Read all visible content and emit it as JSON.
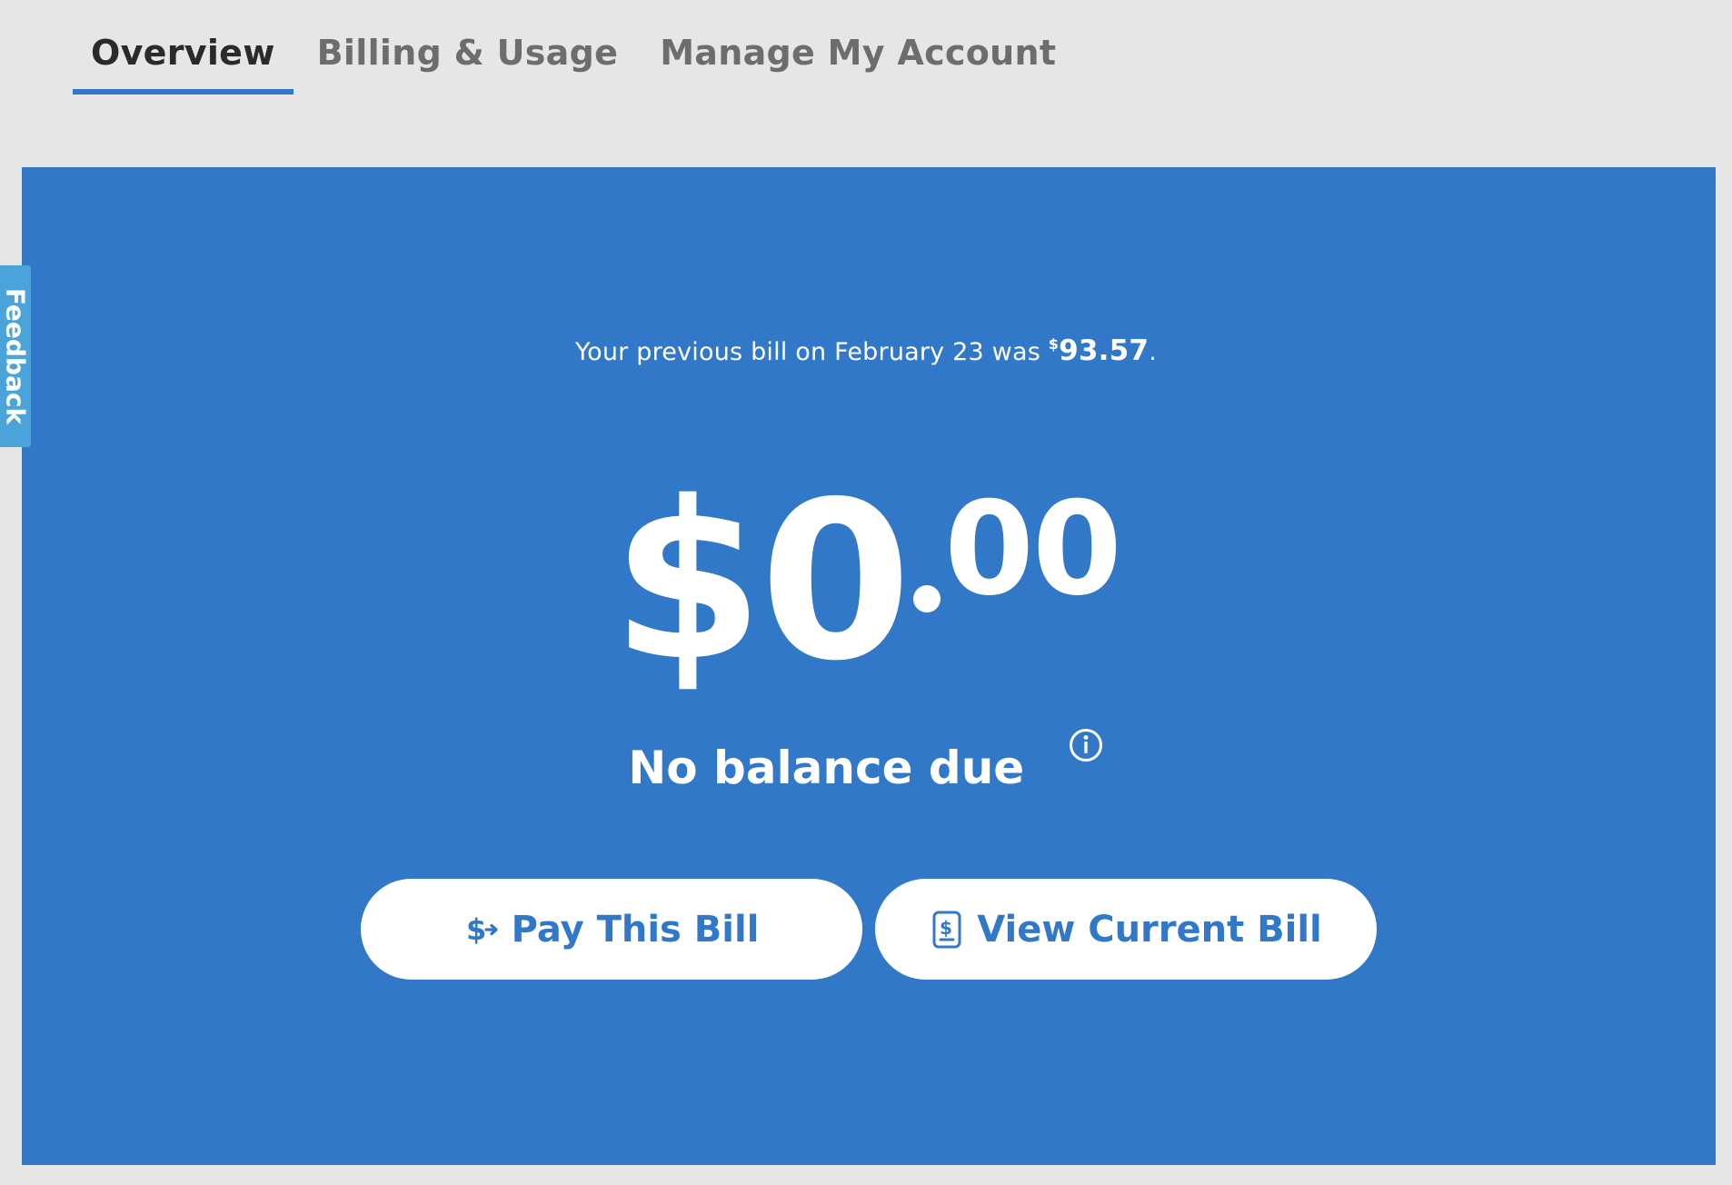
{
  "tabs": [
    {
      "label": "Overview",
      "active": true
    },
    {
      "label": "Billing & Usage",
      "active": false
    },
    {
      "label": "Manage My Account",
      "active": false
    }
  ],
  "feedback": {
    "label": "Feedback"
  },
  "previous_bill": {
    "prefix": "Your previous bill on February 23 was ",
    "currency_symbol": "$",
    "amount": "93.57",
    "suffix": "."
  },
  "balance": {
    "whole": "$0",
    "cents": "00",
    "status": "No balance due"
  },
  "buttons": {
    "pay_label": "Pay This Bill",
    "view_label": "View Current Bill"
  },
  "icons": {
    "pay": "dollar-transfer-icon",
    "view": "bill-document-icon",
    "info": "info-icon"
  },
  "colors": {
    "accent": "#3178c9",
    "background": "#e6e6e6",
    "feedback": "#4aa3d9",
    "tab_active": "#2a2a2a",
    "tab_inactive": "#6d6d6d"
  }
}
